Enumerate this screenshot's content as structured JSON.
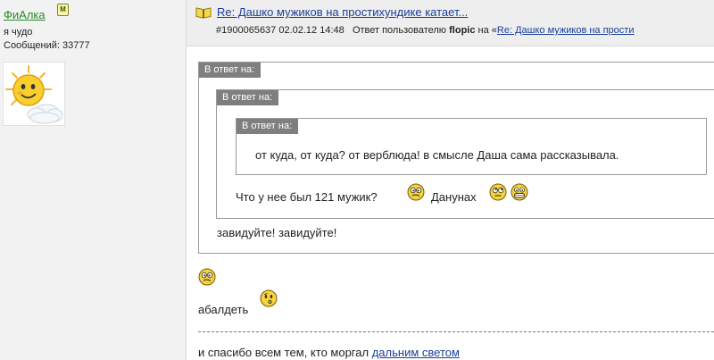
{
  "author": {
    "name": "ФиАлка",
    "badge": "M",
    "status": "я чудо",
    "posts_label": "Сообщений: 33777"
  },
  "message": {
    "title": "Re: Дашко мужиков на простихундике катает...",
    "id_date": "#1900065637 02.02.12 14:48",
    "reply_prefix": "Ответ пользователю",
    "reply_user": "flopic",
    "reply_on": "на «",
    "reply_link": "Re: Дашко мужиков на прости"
  },
  "quotes": {
    "label": "В ответ на:",
    "inner_text": "от куда, от куда? от верблюда! в смысле Даша сама рассказывала.",
    "middle_text_1": "Что у нее был 121 мужик?",
    "middle_text_2": "Данунах",
    "outer_text": "завидуйте! завидуйте!"
  },
  "body": {
    "text": "абалдеть"
  },
  "signature": {
    "text": "и спасибо всем тем, кто моргал",
    "link": "дальним светом"
  },
  "icons": {
    "book": "book-icon",
    "smileys": [
      "confused-smiley-icon",
      "rolling-eyes-smiley-icon",
      "grin-smiley-icon",
      "confused-smiley-icon",
      "wondering-smiley-icon"
    ]
  },
  "colors": {
    "link": "#1a3f9a",
    "author_link": "#2a8a2a",
    "quote_label_bg": "#7f7f7f",
    "smiley_yellow": "#f7d43a"
  }
}
